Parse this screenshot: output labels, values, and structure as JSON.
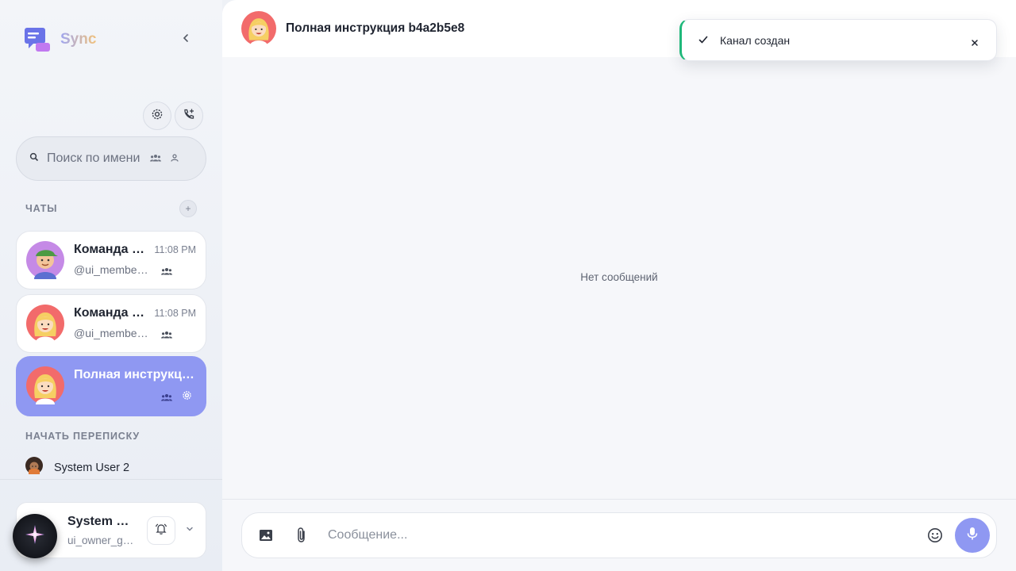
{
  "brand": {
    "name": "Sync"
  },
  "search": {
    "placeholder": "Поиск по имени"
  },
  "sections": {
    "chats": "ЧАТЫ",
    "start": "НАЧАТЬ ПЕРЕПИСКУ",
    "add_chat": "+"
  },
  "chats": [
    {
      "title": "Команда п…",
      "time": "11:08 PM",
      "subtitle": "@ui_member_…",
      "avatar": "green-cap-avatar"
    },
    {
      "title": "Команда 5…",
      "time": "11:08 PM",
      "subtitle": "@ui_member_…",
      "avatar": "blonde-girl-avatar"
    },
    {
      "title": "Полная инструкци…",
      "time": "",
      "subtitle": "",
      "avatar": "blonde-girl-avatar",
      "active": true
    }
  ],
  "contacts": [
    {
      "name": "System User 2",
      "avatar": "curly-hair-avatar"
    }
  ],
  "user": {
    "name": "System U…",
    "handle": "ui_owner_g…"
  },
  "chat": {
    "title": "Полная инструкция b4a2b5e8",
    "empty_text": "Нет сообщений"
  },
  "composer": {
    "placeholder": "Сообщение..."
  },
  "toast": {
    "message": "Канал создан"
  },
  "colors": {
    "accent": "#8f98f2",
    "success": "#1fb87a",
    "avatar_bg": "#f26b6b"
  }
}
